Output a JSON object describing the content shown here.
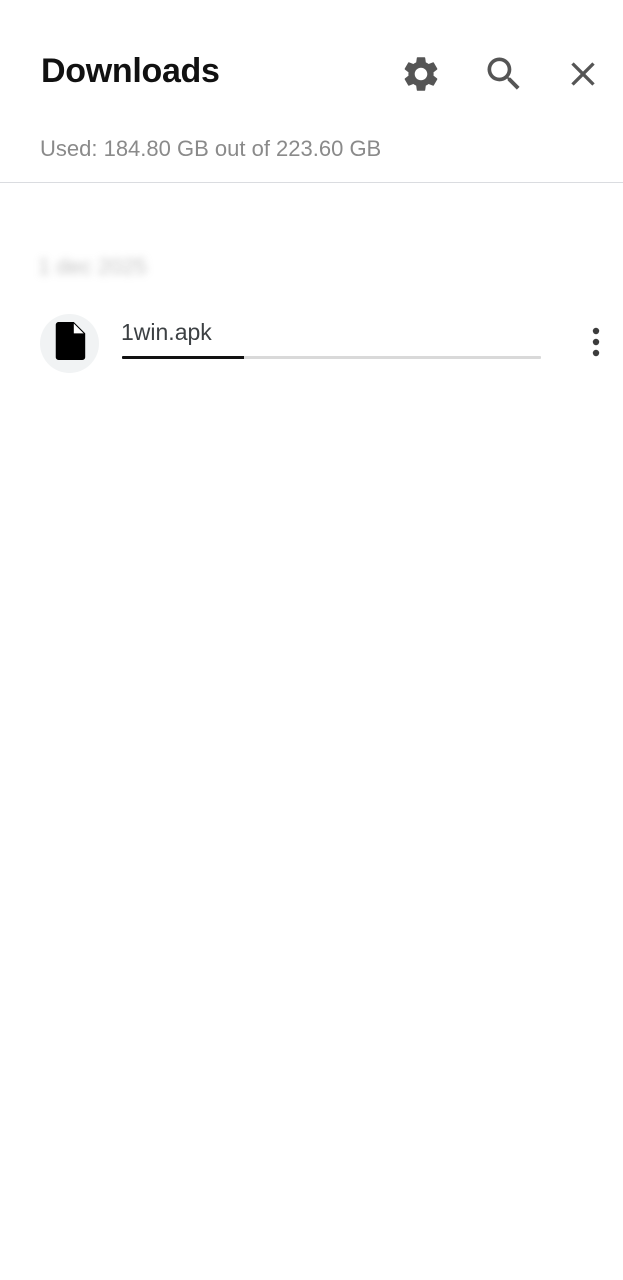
{
  "header": {
    "title": "Downloads",
    "storage_text": "Used: 184.80 GB out of 223.60 GB",
    "settings_icon": "gear-icon",
    "search_icon": "search-icon",
    "close_icon": "close-icon"
  },
  "list": {
    "date_label": "1 dec 2025",
    "items": [
      {
        "file_name": "1win.apk",
        "icon": "file-icon",
        "progress": 0.29,
        "menu_icon": "more-vert-icon"
      }
    ]
  },
  "colors": {
    "progress_fill": "#111111",
    "progress_track": "#d9d9d9",
    "icon": "#555555"
  }
}
